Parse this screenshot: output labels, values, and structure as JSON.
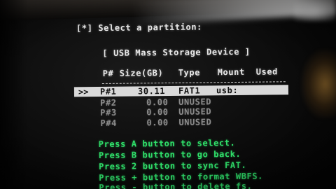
{
  "header": {
    "prompt": "[*] Select a partition:",
    "device": "[ USB Mass Storage Device ]"
  },
  "table": {
    "columns": [
      "P#",
      "Size(GB)",
      "Type",
      "Mount",
      "Used"
    ],
    "rows": [
      {
        "marker": ">>",
        "p": "P#1",
        "size": "30.11",
        "type": "FAT1",
        "mount": "usb:",
        "selected": true
      },
      {
        "marker": "",
        "p": "P#2",
        "size": "0.00",
        "type": "UNUSED",
        "mount": "",
        "selected": false
      },
      {
        "marker": "",
        "p": "P#3",
        "size": "0.00",
        "type": "UNUSED",
        "mount": "",
        "selected": false
      },
      {
        "marker": "",
        "p": "P#4",
        "size": "0.00",
        "type": "UNUSED",
        "mount": "",
        "selected": false
      }
    ]
  },
  "instructions": [
    "Press A button to select.",
    "Press B button to go back.",
    "Press 2 button to sync FAT.",
    "Press + button to format WBFS.",
    "Press - button to delete fs."
  ],
  "colors": {
    "text": "#e8e8e8",
    "dim": "#8c8c8c",
    "instruction": "#2fe06a",
    "highlight": "#d9d9d9"
  }
}
